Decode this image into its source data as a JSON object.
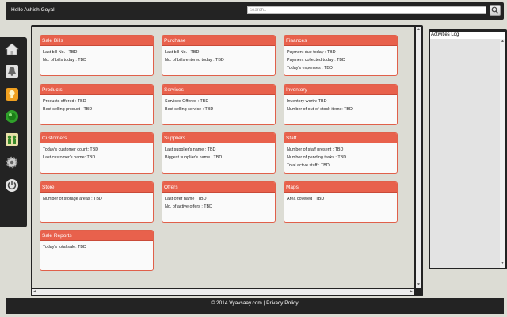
{
  "header": {
    "greeting": "Hello Ashish Goyal",
    "search_placeholder": "search..",
    "search_button_icon": "search-icon"
  },
  "sidenav": {
    "items": [
      {
        "name": "home",
        "icon": "home-icon"
      },
      {
        "name": "notifications",
        "icon": "bell-icon"
      },
      {
        "name": "ideas",
        "icon": "lightbulb-icon"
      },
      {
        "name": "status",
        "icon": "online-icon"
      },
      {
        "name": "users",
        "icon": "users-icon"
      },
      {
        "name": "settings",
        "icon": "gear-icon"
      },
      {
        "name": "logout",
        "icon": "power-icon"
      }
    ]
  },
  "cards": [
    {
      "title": "Sale Bills",
      "lines": [
        "Last bill No. : TBD",
        "No. of bills today : TBD"
      ]
    },
    {
      "title": "Purchase",
      "lines": [
        "Last bill No. : TBD",
        "No. of bills entered today : TBD"
      ]
    },
    {
      "title": "Finances",
      "lines": [
        "Payment due today : TBD",
        "Payment collected today : TBD",
        "Today's expenses : TBD"
      ]
    },
    {
      "title": "Products",
      "lines": [
        "Products offered : TBD",
        "Best selling product : TBD"
      ]
    },
    {
      "title": "Services",
      "lines": [
        "Services Offered : TBD",
        "Best selling service : TBD"
      ]
    },
    {
      "title": "Inventory",
      "lines": [
        "Inventory worth: TBD",
        "Number of out-of-stock items: TBD"
      ]
    },
    {
      "title": "Customers",
      "lines": [
        "Today's customer count: TBD",
        "Last customer's name: TBD"
      ]
    },
    {
      "title": "Suppliers",
      "lines": [
        "Last supplier's name : TBD",
        "Biggest supplier's name : TBD"
      ]
    },
    {
      "title": "Staff",
      "lines": [
        "Number of staff present : TBD",
        "Number of pending tasks : TBD",
        "Total active staff : TBD"
      ]
    },
    {
      "title": "Store",
      "lines": [
        "Number of storage areas : TBD"
      ]
    },
    {
      "title": "Offers",
      "lines": [
        "Last offer name : TBD",
        "No. of active offers : TBD"
      ]
    },
    {
      "title": "Maps",
      "lines": [
        "Area covered : TBD"
      ]
    },
    {
      "title": "Sale Reports",
      "lines": [
        "Today's total sale: TBD"
      ]
    }
  ],
  "activities": {
    "title": "Activities Log"
  },
  "footer": {
    "copyright": "© 2014 Vyavsaay.com",
    "separator": "|",
    "privacy_link": "Privacy Policy"
  },
  "colors": {
    "card_header": "#e8614c",
    "chrome": "#232323",
    "background": "#dcdcd4"
  }
}
